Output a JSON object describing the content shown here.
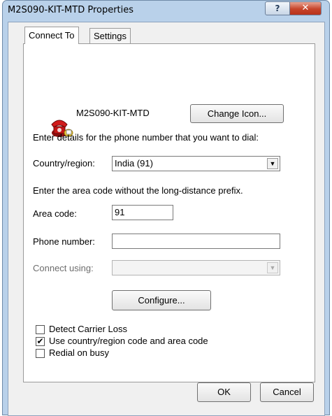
{
  "window": {
    "title": "M2S090-KIT-MTD Properties",
    "help_label": "?",
    "close_label": "✕"
  },
  "tabs": [
    {
      "label": "Connect To",
      "active": true
    },
    {
      "label": "Settings",
      "active": false
    }
  ],
  "connection": {
    "name": "M2S090-KIT-MTD",
    "icon": "phone-connection-icon",
    "change_icon_label": "Change Icon..."
  },
  "instructions": {
    "dial_details": "Enter details for the phone number that you want to dial:",
    "area_code_hint": "Enter the area code without the long-distance prefix."
  },
  "country": {
    "label": "Country/region:",
    "value": "India (91)"
  },
  "area_code": {
    "label": "Area code:",
    "value": "91"
  },
  "phone_number": {
    "label": "Phone number:",
    "value": ""
  },
  "connect_using": {
    "label": "Connect using:",
    "value": "",
    "disabled": true
  },
  "configure_label": "Configure...",
  "options": [
    {
      "label": "Detect Carrier Loss",
      "checked": false
    },
    {
      "label": "Use country/region code and area code",
      "checked": true
    },
    {
      "label": "Redial on busy",
      "checked": false
    }
  ],
  "buttons": {
    "ok": "OK",
    "cancel": "Cancel"
  },
  "colors": {
    "frame": "#b9d1ea",
    "close_button": "#c7442a",
    "dialog_background": "#f0f0f0"
  }
}
